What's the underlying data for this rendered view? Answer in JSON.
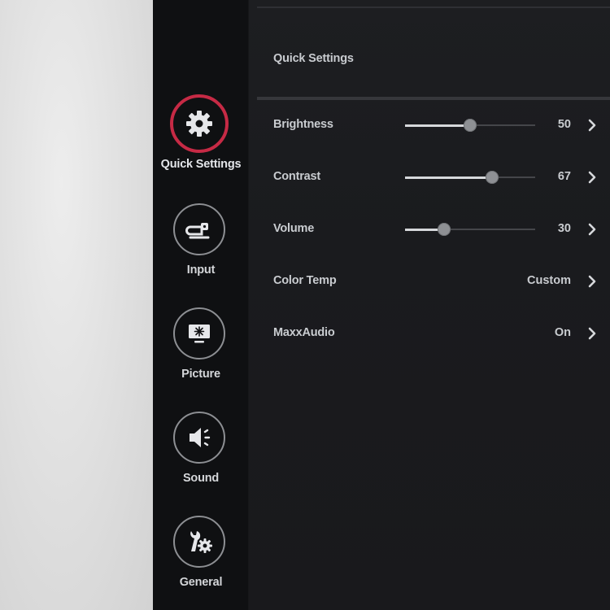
{
  "sidebar": {
    "items": [
      {
        "label": "Quick Settings",
        "icon": "gear-icon",
        "active": true
      },
      {
        "label": "Input",
        "icon": "input-plug-icon",
        "active": false
      },
      {
        "label": "Picture",
        "icon": "monitor-icon",
        "active": false
      },
      {
        "label": "Sound",
        "icon": "speaker-icon",
        "active": false
      },
      {
        "label": "General",
        "icon": "wrench-gear-icon",
        "active": false
      }
    ]
  },
  "panel": {
    "title": "Quick Settings",
    "rows": [
      {
        "label": "Brightness",
        "type": "slider",
        "value": "50",
        "level": 50
      },
      {
        "label": "Contrast",
        "type": "slider",
        "value": "67",
        "level": 67
      },
      {
        "label": "Volume",
        "type": "slider",
        "value": "30",
        "level": 30
      },
      {
        "label": "Color Temp",
        "type": "option",
        "value": "Custom"
      },
      {
        "label": "MaxxAudio",
        "type": "option",
        "value": "On"
      }
    ]
  },
  "colors": {
    "accent": "#c62a45",
    "sidebar_bg": "#0f1012",
    "panel_bg": "#1b1c1f",
    "text": "#c9ccd0"
  }
}
